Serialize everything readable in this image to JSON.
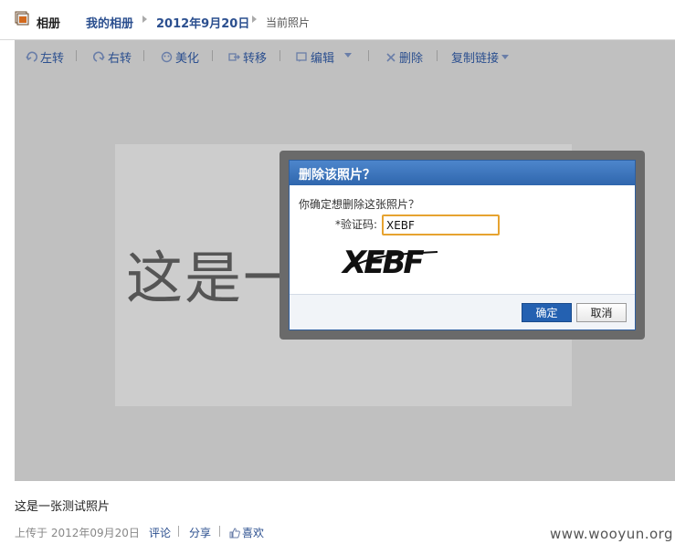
{
  "header": {
    "title": "相册",
    "my_albums": "我的相册",
    "album_date": "2012年9月20日",
    "current": "当前照片"
  },
  "toolbar": {
    "rotate_left": "左转",
    "rotate_right": "右转",
    "beautify": "美化",
    "move": "转移",
    "edit": "编辑",
    "delete": "删除",
    "copy_link": "复制链接"
  },
  "photo": {
    "text": "这是一"
  },
  "dialog": {
    "title": "删除该照片？",
    "message": "你确定想删除这张照片？",
    "captcha_label": "*验证码:",
    "captcha_value": "XEBF",
    "captcha_image_text": "XEBF",
    "ok_label": "确定",
    "cancel_label": "取消"
  },
  "caption": "这是一张测试照片",
  "meta": {
    "uploaded": "上传于 2012年09月20日",
    "comment": "评论",
    "share": "分享",
    "like": "喜欢"
  },
  "watermark": "www.wooyun.org",
  "colors": {
    "accent": "#2461b1",
    "link": "#2b4f8f",
    "input_focus": "#e6a330"
  }
}
